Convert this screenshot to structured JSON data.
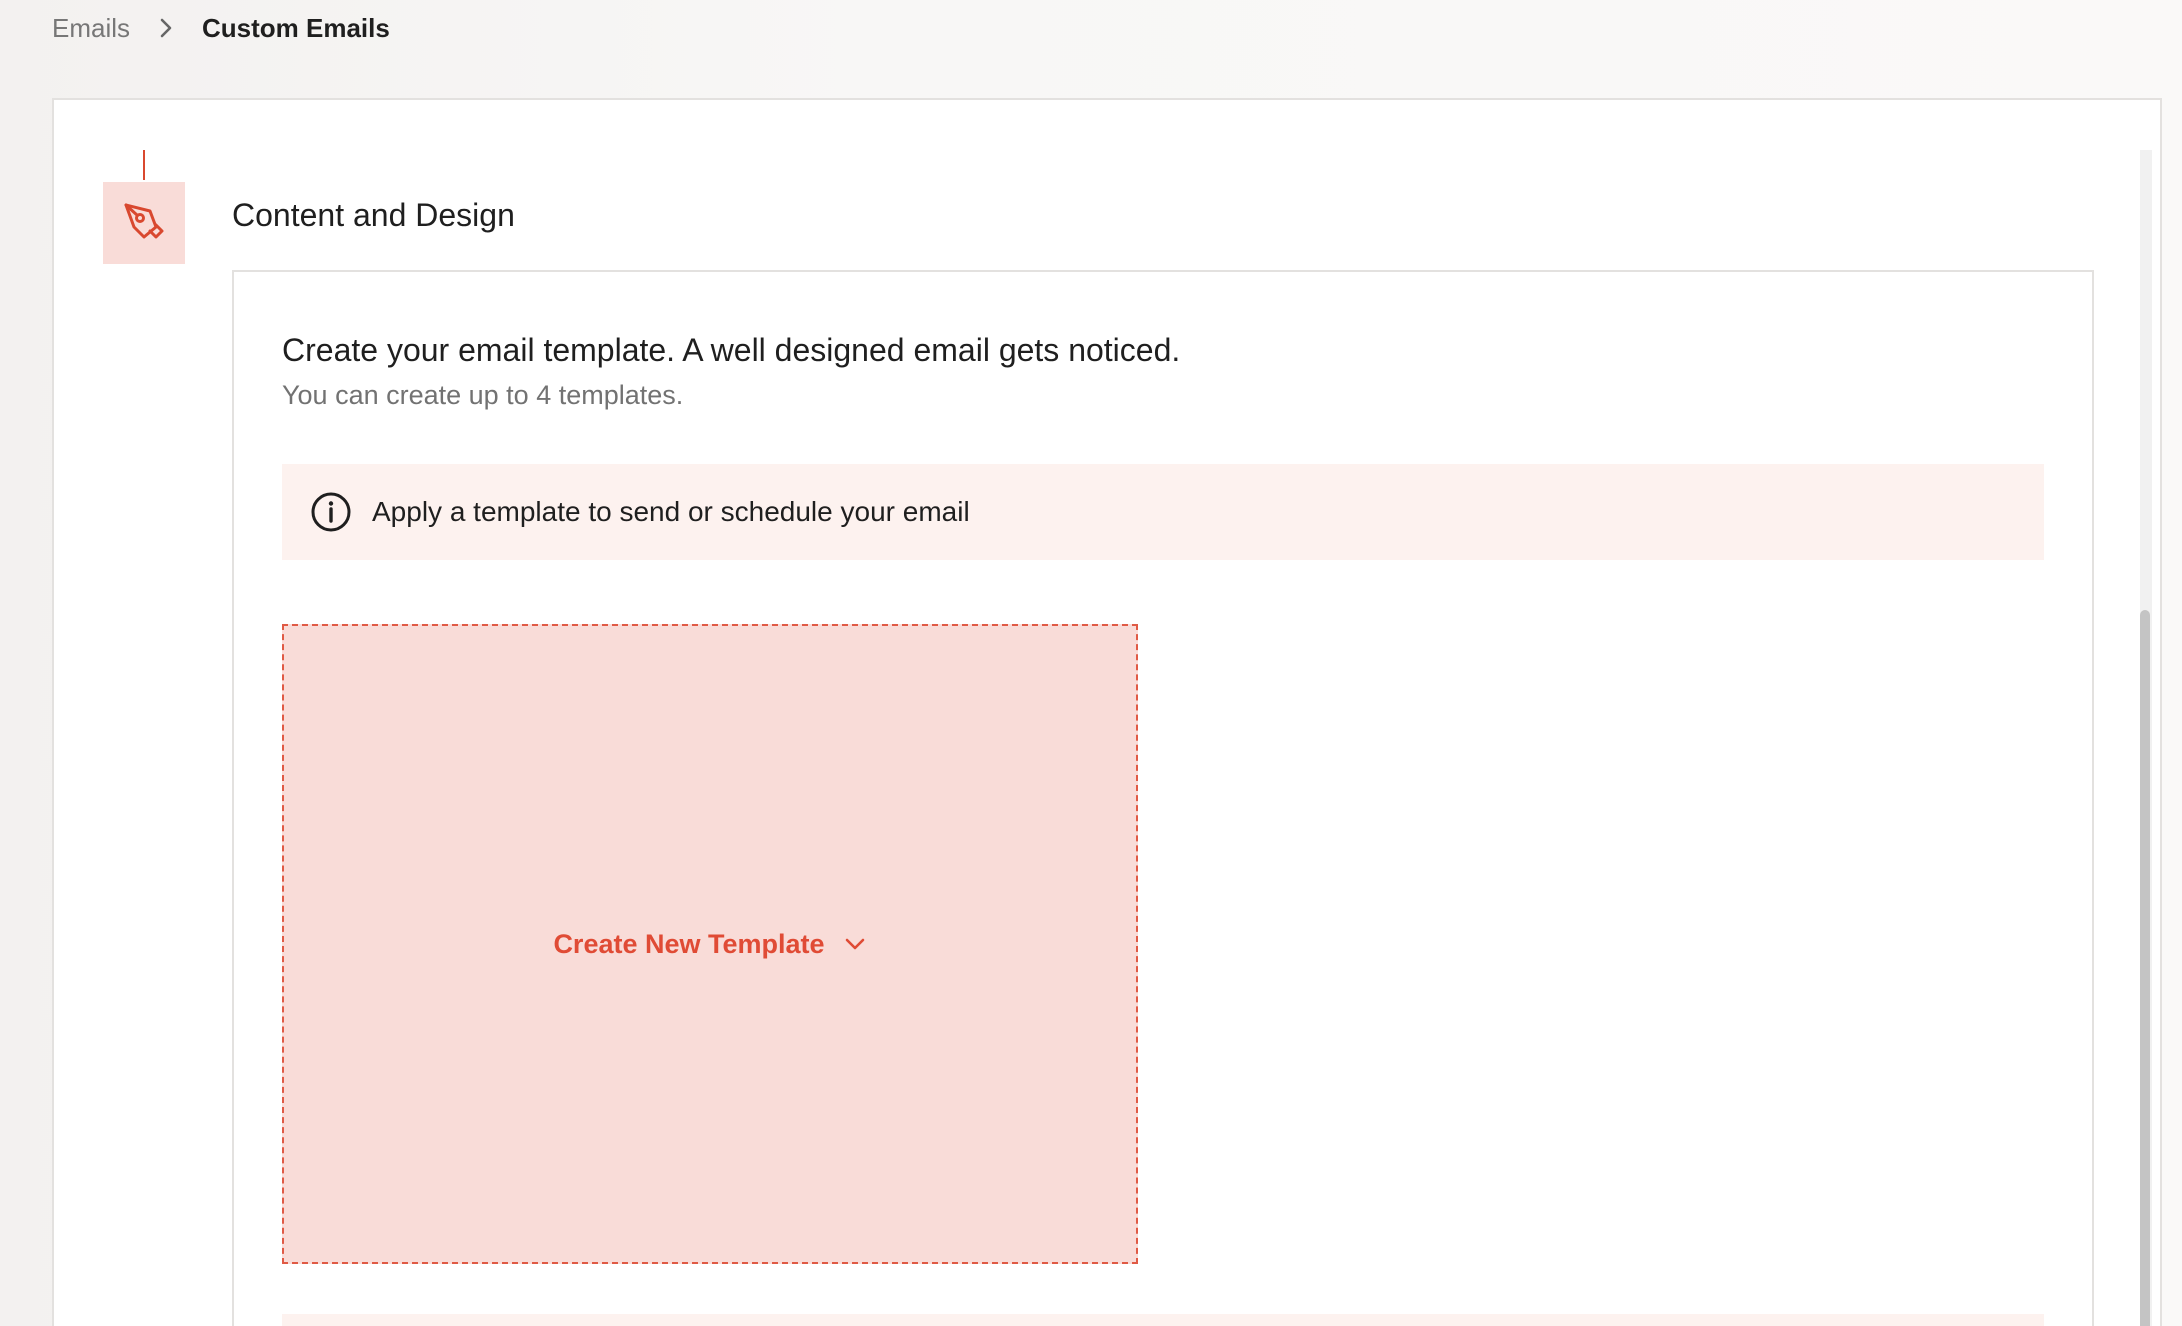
{
  "breadcrumb": {
    "parent": "Emails",
    "current": "Custom Emails"
  },
  "step": {
    "title": "Content and Design",
    "icon": "pen-nib-icon"
  },
  "content": {
    "heading": "Create your email template. A well designed email gets noticed.",
    "subheading": "You can create up to 4 templates.",
    "info_banner": {
      "icon": "info-icon",
      "text": "Apply a template to send or schedule your email"
    },
    "create_template": {
      "label": "Create New Template",
      "icon": "chevron-down-icon"
    }
  },
  "colors": {
    "accent": "#e04b35",
    "accent_light": "#f9dcd8",
    "banner_bg": "#fdf2ef"
  }
}
